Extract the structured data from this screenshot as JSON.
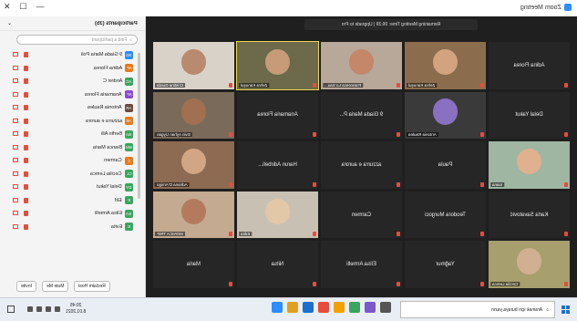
{
  "window": {
    "title": "Zoom Meeting",
    "controls": [
      "✕",
      "☐",
      "—"
    ]
  },
  "banner": "Remaining Meeting Time: 06:39 | Upgrade to Pro",
  "panel": {
    "title": "Participants (35)",
    "search_placeholder": "Find a participant",
    "participants": [
      {
        "name": "9 Giada Maria Poli",
        "initials": "9G",
        "color": "#2d8cff"
      },
      {
        "name": "Adina Florea",
        "initials": "AF",
        "color": "#e6791e"
      },
      {
        "name": "Andrei C",
        "initials": "AC",
        "color": "#3aa55d"
      },
      {
        "name": "Anamaria Florea",
        "initials": "AF",
        "color": "#8a4bd1"
      },
      {
        "name": "Antonia Raulea",
        "initials": "AR",
        "color": "#6b4a3a"
      },
      {
        "name": "azzurra e aurora",
        "initials": "AE",
        "color": "#e6791e"
      },
      {
        "name": "Berfin Alli",
        "initials": "BA",
        "color": "#3aa55d"
      },
      {
        "name": "Bianca Maria",
        "initials": "BM",
        "color": "#3aa55d"
      },
      {
        "name": "Carmen",
        "initials": "C",
        "color": "#e6791e"
      },
      {
        "name": "Cecilia Lemca",
        "initials": "CL",
        "color": "#3aa55d"
      },
      {
        "name": "Delal Yakut",
        "initials": "DY",
        "color": "#3aa55d"
      },
      {
        "name": "Elif",
        "initials": "E",
        "color": "#3aa55d"
      },
      {
        "name": "Elisa Armelli",
        "initials": "EA",
        "color": "#3aa55d"
      },
      {
        "name": "Evita",
        "initials": "E",
        "color": "#3aa55d"
      }
    ],
    "footer": [
      "Invite",
      "Mute Me",
      "Reclaim Host"
    ]
  },
  "tiles": [
    {
      "name": "Cristina Gurda",
      "type": "video",
      "bg": "#d9d2c8",
      "face": "#b98a6e"
    },
    {
      "name": "Zehra Kanuşul",
      "type": "video",
      "bg": "#6c6a4a",
      "face": "#c79a78",
      "active": true
    },
    {
      "name": "Francesca Lo Sau...",
      "type": "video",
      "bg": "#b7a89a",
      "face": "#c4876a"
    },
    {
      "name": "Zehra Kanuşul",
      "type": "video",
      "bg": "#8b6d4d",
      "face": "#d3a27f"
    },
    {
      "name": "Adina Florea",
      "type": "name"
    },
    {
      "name": "Evin Ayhan Uygan",
      "type": "video",
      "bg": "#7a6a5a",
      "face": "#a07050"
    },
    {
      "name": "Anamaria Florea",
      "type": "name"
    },
    {
      "name": "9 Giada Maria P...",
      "type": "name"
    },
    {
      "name": "Antonia Raulea",
      "type": "video",
      "bg": "#3a3a3a",
      "face": "#8a70c0"
    },
    {
      "name": "Delal Yakut",
      "type": "name"
    },
    {
      "name": "Adriana D'Amigo",
      "type": "video",
      "bg": "#8c6b52",
      "face": "#d2a584"
    },
    {
      "name": "Harun Adirbeli...",
      "type": "name"
    },
    {
      "name": "azzurra e aurora",
      "type": "name"
    },
    {
      "name": "Paula",
      "type": "name"
    },
    {
      "name": "Ioana",
      "type": "video",
      "bg": "#9fb6a2",
      "face": "#e0b08f"
    },
    {
      "name": "MONICA TRIF",
      "type": "video",
      "bg": "#c4aa90",
      "face": "#b47a5e"
    },
    {
      "name": "Edita",
      "type": "video",
      "bg": "#c9c0b4",
      "face": "#e3c8a8"
    },
    {
      "name": "Carmen",
      "type": "name"
    },
    {
      "name": "Teodora Murgoci",
      "type": "name"
    },
    {
      "name": "Karla Savatović",
      "type": "name"
    },
    {
      "name": "Maria",
      "type": "name"
    },
    {
      "name": "Nilsa",
      "type": "name"
    },
    {
      "name": "Elisa Armelli",
      "type": "name"
    },
    {
      "name": "Yağmur",
      "type": "name"
    },
    {
      "name": "Cecilia Lemca",
      "type": "video",
      "bg": "#a79f6e",
      "face": "#d0b090"
    }
  ],
  "taskbar": {
    "search_placeholder": "Aramak için buraya yazın",
    "time": "20:45",
    "date": "8.01.2021",
    "apps": [
      "#2d8cff",
      "#e0a020",
      "#1b6fd0",
      "#e74c3c",
      "#f2a100",
      "#3aa55d",
      "#7a59c9",
      "#555555"
    ]
  }
}
